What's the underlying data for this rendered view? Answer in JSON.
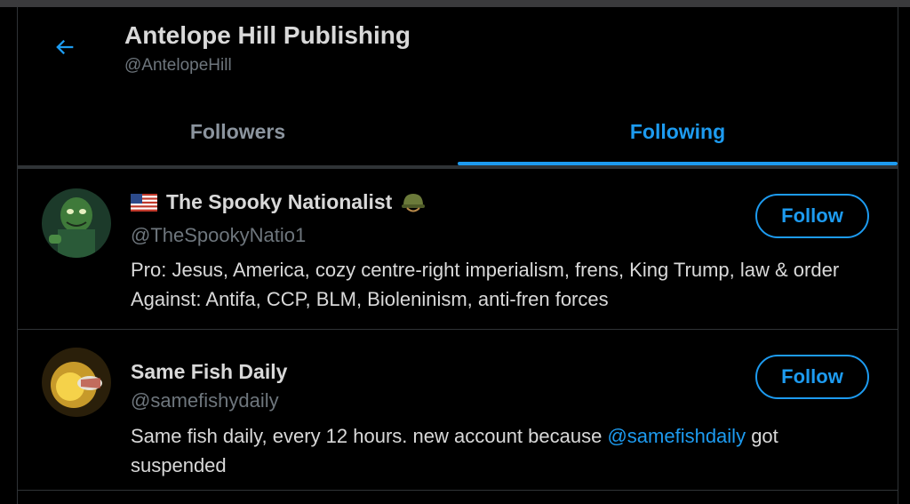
{
  "header": {
    "title": "Antelope Hill Publishing",
    "handle": "@AntelopeHill"
  },
  "tabs": [
    {
      "label": "Followers",
      "active": false
    },
    {
      "label": "Following",
      "active": true
    }
  ],
  "users": [
    {
      "name": "The Spooky Nationalist",
      "name_prefix_icon": "us-flag-icon",
      "name_suffix_icon": "army-helmet-icon",
      "handle": "@TheSpookyNatio1",
      "bio": "Pro: Jesus, America, cozy centre-right imperialism, frens, King Trump, law & order Against: Antifa, CCP, BLM, Bioleninism, anti-fren forces",
      "follow_label": "Follow"
    },
    {
      "name": "Same Fish Daily",
      "handle": "@samefishydaily",
      "bio_before": "Same fish daily, every 12 hours. new account because ",
      "bio_link": "@samefishdaily",
      "bio_after": " got suspended",
      "follow_label": "Follow"
    }
  ],
  "colors": {
    "accent": "#1d9bf0",
    "background": "#000000",
    "divider": "#2f3336",
    "secondary_text": "#6e767d"
  }
}
